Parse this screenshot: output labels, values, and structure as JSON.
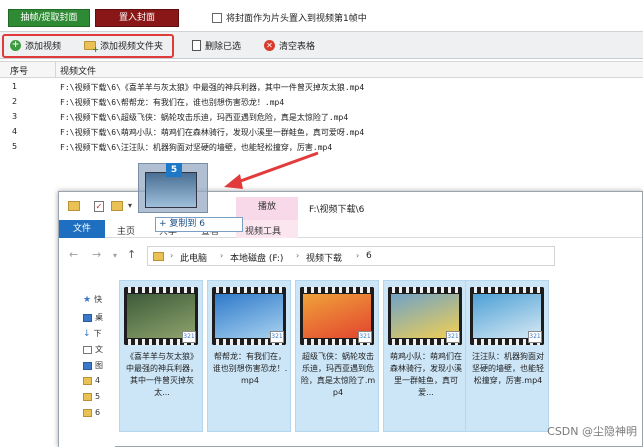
{
  "top": {
    "extract_cover_label": "抽帧/提取封面",
    "insert_cover_label": "置入封面",
    "checkbox_label": "将封面作为片头置入到视频第1帧中"
  },
  "toolbar": {
    "add_video_label": "添加视频",
    "add_folder_label": "添加视频文件夹",
    "delete_selected_label": "删除已选",
    "clear_table_label": "清空表格"
  },
  "table": {
    "col_no": "序号",
    "col_file": "视频文件",
    "rows": [
      {
        "no": "1",
        "path": "F:\\视频下载\\6\\《喜羊羊与灰太狼》中最强的神兵利器，其中一件曾灭掉灰太狼.mp4"
      },
      {
        "no": "2",
        "path": "F:\\视频下载\\6\\帮帮龙：有我们在，谁也别想伤害恐龙！.mp4"
      },
      {
        "no": "3",
        "path": "F:\\视频下载\\6\\超级飞侠：蜗轮攻击乐迪，玛西亚遇到危险，真是太惊险了.mp4"
      },
      {
        "no": "4",
        "path": "F:\\视频下载\\6\\萌鸡小队：萌鸡们在森林骑行，发现小溪里一群鲑鱼，真可爱呀.mp4"
      },
      {
        "no": "5",
        "path": "F:\\视频下载\\6\\汪汪队：机器狗面对坚硬的墙壁，也能轻松撞穿，厉害.mp4"
      }
    ]
  },
  "drag": {
    "count": "5",
    "copy_tip": "+ 复制到 6"
  },
  "explorer": {
    "play_tab": "播放",
    "title_path": "F:\\视频下载\\6",
    "tabs": [
      "文件",
      "主页",
      "共享",
      "查看",
      "视频工具"
    ],
    "breadcrumbs": [
      "此电脑",
      "本地磁盘 (F:)",
      "视频下载",
      "6"
    ],
    "sidebar": [
      "快",
      "桌",
      "下",
      "文",
      "图",
      "4",
      "5",
      "6"
    ],
    "files": [
      {
        "label": "《喜羊羊与灰太狼》中最强的神兵利器，其中一件曾灭掉灰太...",
        "color1": "#3c5b3a",
        "color2": "#8fa36c"
      },
      {
        "label": "帮帮龙：有我们在，谁也别想伤害恐龙！.mp4",
        "color1": "#2f7ac9",
        "color2": "#a8d2f0"
      },
      {
        "label": "超级飞侠：蜗轮攻击乐迪，玛西亚遇到危险，真是太惊险了.mp4",
        "color1": "#f0a23a",
        "color2": "#e2442f"
      },
      {
        "label": "萌鸡小队：萌鸡们在森林骑行，发现小溪里一群鲑鱼，真可爱...",
        "color1": "#6fa2c7",
        "color2": "#f2cf52"
      },
      {
        "label": "汪汪队：机器狗面对坚硬的墙壁，也能轻松撞穿，厉害.mp4",
        "color1": "#4da0d6",
        "color2": "#d7e9f3"
      }
    ]
  },
  "watermark": "CSDN @尘隐神明"
}
